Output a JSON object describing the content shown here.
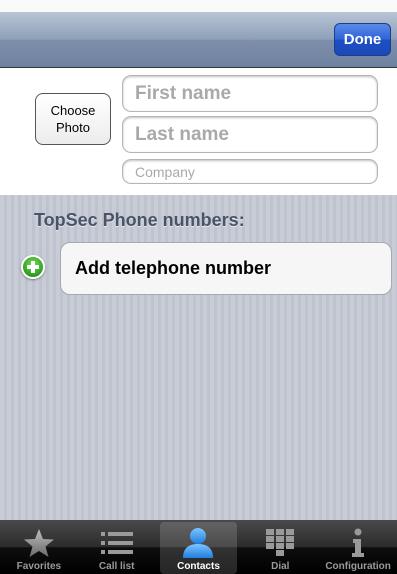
{
  "navbar": {
    "done_label": "Done"
  },
  "name_section": {
    "choose_photo_label": "Choose\nPhoto",
    "first_name_placeholder": "First name",
    "last_name_placeholder": "Last name",
    "company_placeholder": "Company"
  },
  "phone_section": {
    "title": "TopSec Phone numbers:",
    "add_label": "Add telephone number"
  },
  "tabbar": {
    "tabs": [
      {
        "label": "Favorites",
        "icon": "star-icon",
        "active": false
      },
      {
        "label": "Call list",
        "icon": "list-icon",
        "active": false
      },
      {
        "label": "Contacts",
        "icon": "person-icon",
        "active": true
      },
      {
        "label": "Dial",
        "icon": "keypad-icon",
        "active": false
      },
      {
        "label": "Configuration",
        "icon": "info-icon",
        "active": false
      }
    ]
  },
  "colors": {
    "done_button": "#2f63d8",
    "add_icon": "#2f9e1e",
    "active_tab_icon": "#3d9bf0"
  }
}
